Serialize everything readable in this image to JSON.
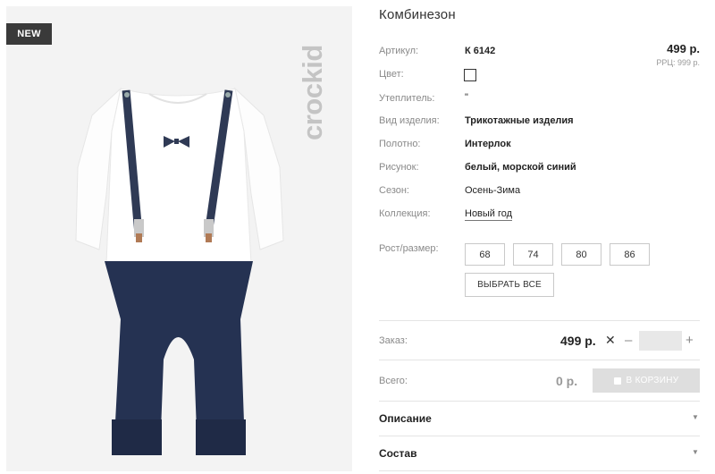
{
  "product": {
    "badge": "NEW",
    "brand": "crockid",
    "title": "Комбинезон"
  },
  "specs": [
    {
      "label": "Артикул:",
      "value": "К 6142"
    },
    {
      "label": "Цвет:",
      "value": ""
    },
    {
      "label": "Утеплитель:",
      "value": "\""
    },
    {
      "label": "Вид изделия:",
      "value": "Трикотажные изделия"
    },
    {
      "label": "Полотно:",
      "value": "Интерлок"
    },
    {
      "label": "Рисунок:",
      "value": "белый, морской синий"
    },
    {
      "label": "Сезон:",
      "value": "Осень-Зима"
    },
    {
      "label": "Коллекция:",
      "value": "Новый год"
    }
  ],
  "price": {
    "main": "499 р.",
    "rrp": "РРЦ: 999 р."
  },
  "sizes": {
    "label": "Рост/размер:",
    "options": [
      "68",
      "74",
      "80",
      "86"
    ],
    "select_all": "ВЫБРАТЬ ВСЕ"
  },
  "order": {
    "label": "Заказ:",
    "price": "499 р.",
    "times": "✕",
    "minus": "–",
    "quantity": "",
    "plus": "+"
  },
  "total": {
    "label": "Всего:",
    "value": "0 р.",
    "cart_button": "В КОРЗИНУ"
  },
  "accordion": [
    {
      "title": "Описание"
    },
    {
      "title": "Состав"
    }
  ],
  "icons": {
    "times": "close-icon",
    "cart": "cart-icon",
    "chevron": "chevron-down-icon"
  },
  "colors": {
    "garment_top": "#ffffff",
    "garment_bottom": "#253252",
    "suspenders": "#2f3a55",
    "swatch": "#ffffff"
  }
}
